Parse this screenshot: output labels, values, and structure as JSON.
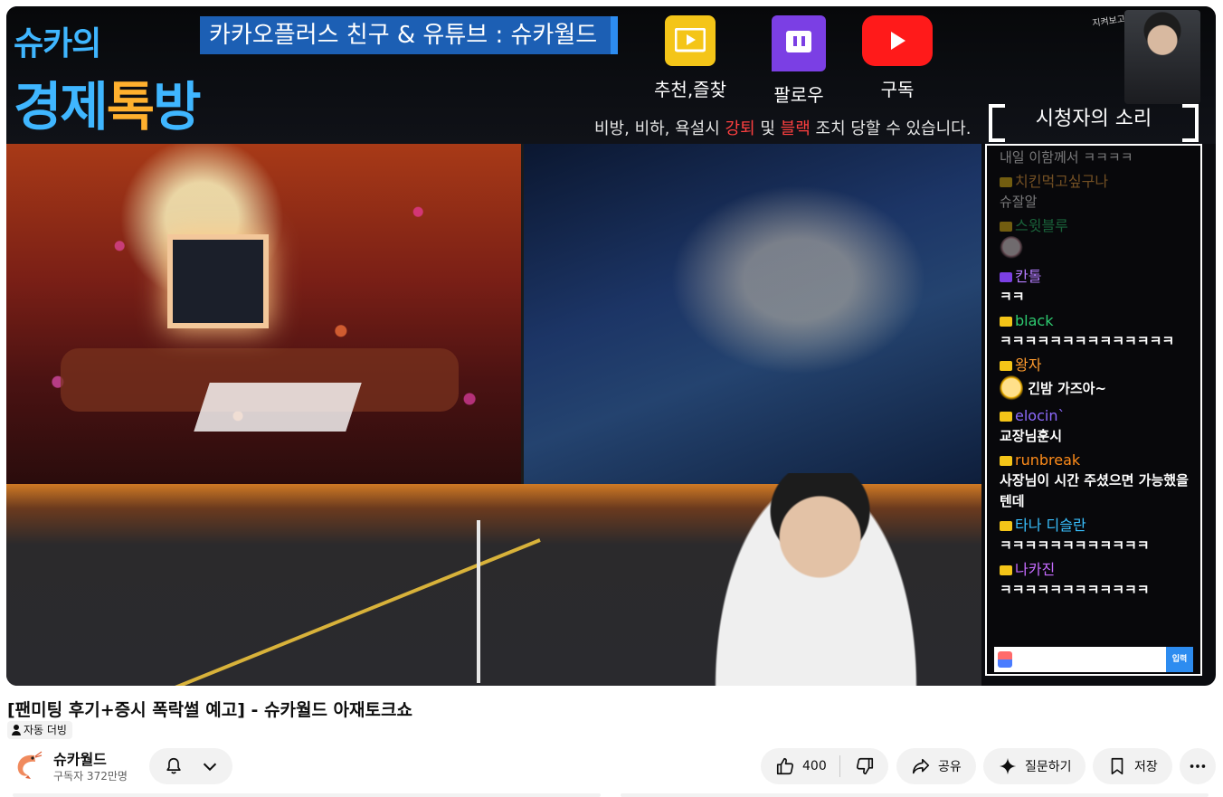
{
  "stream": {
    "logo_line1": "슈카의",
    "logo_line2_a": "경제",
    "logo_line2_b": "톡",
    "logo_line2_c": "방",
    "promo_banner": "카카오플러스 친구 & 유튜브 : 슈카월드",
    "actions": [
      {
        "label": "추천,즐찾",
        "icon": "kakao-play-icon"
      },
      {
        "label": "팔로우",
        "icon": "twitch-icon"
      },
      {
        "label": "구독",
        "icon": "youtube-icon"
      }
    ],
    "warning_prefix": "비방, 비하, 욕설시 ",
    "warning_red1": "강퇴",
    "warning_mid": " 및 ",
    "warning_red2": "블랙",
    "warning_suffix": " 조치 당할 수 있습니다.",
    "cam_caption": "지켜보고 싶다",
    "chat_title": "시청자의 소리",
    "chat_send": "입력",
    "chat": [
      {
        "user": "",
        "text": "내일 이함께서 ㅋㅋㅋㅋ",
        "color": "#ffffff",
        "dim": true
      },
      {
        "user": "치킨먹고싶구나",
        "text": "슈잘알",
        "color": "#f4a640",
        "dim": true
      },
      {
        "user": "스윗블루",
        "text": "",
        "color": "#2ecc71",
        "dim": true,
        "sticker": "pink"
      },
      {
        "user": "칸톨",
        "text": "ㅋㅋ",
        "color": "#b47cff",
        "platform": "twitch"
      },
      {
        "user": "black",
        "text": "ㅋㅋㅋㅋㅋㅋㅋㅋㅋㅋㅋㅋㅋㅋ",
        "color": "#2ecc71"
      },
      {
        "user": "왕자",
        "text": "긴밤 가즈아~",
        "color": "#ff9b2e",
        "sticker": "gold"
      },
      {
        "user": "elocin`",
        "text": "교장님훈시",
        "color": "#8e6bff"
      },
      {
        "user": "runbreak",
        "text": "사장님이 시간 주셨으면 가능했을텐데",
        "color": "#ff8c1a"
      },
      {
        "user": "타나 디슬란",
        "text": "ㅋㅋㅋㅋㅋㅋㅋㅋㅋㅋㅋㅋ",
        "color": "#39c0ff"
      },
      {
        "user": "나카진",
        "text": "ㅋㅋㅋㅋㅋㅋㅋㅋㅋㅋㅋㅋ",
        "color": "#c66bff"
      }
    ]
  },
  "video": {
    "title": "[팬미팅 후기+증시 폭락썰 예고] - 슈카월드 아재토크쇼",
    "dub_badge": "자동 더빙"
  },
  "channel": {
    "name": "슈카월드",
    "subscribers": "구독자 372만명",
    "avatar_icon": "shrimp-icon"
  },
  "actions": {
    "like_count": "400",
    "share": "공유",
    "ask": "질문하기",
    "save": "저장"
  }
}
